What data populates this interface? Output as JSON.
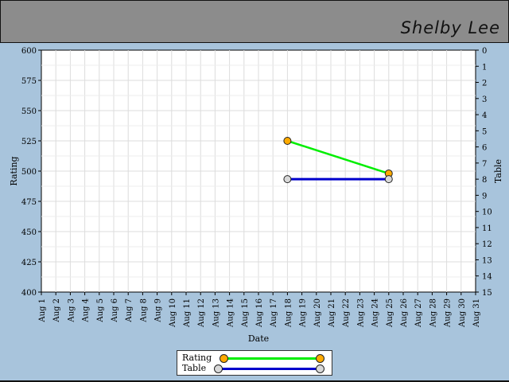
{
  "header": {
    "player_name": "Shelby Lee"
  },
  "colors": {
    "rating_line": "#00ee00",
    "table_line": "#0000cc",
    "rating_marker": "#ffaa00",
    "table_marker": "#d8d8d8"
  },
  "chart_data": {
    "type": "line",
    "xlabel": "Date",
    "ylabel": "Rating",
    "y2label": "Table",
    "ylim": [
      400,
      600
    ],
    "y2lim": [
      0,
      15
    ],
    "y2_reversed": true,
    "grid": true,
    "legend_placement": "bottom-center",
    "x_categories": [
      "Aug 1",
      "Aug 2",
      "Aug 3",
      "Aug 4",
      "Aug 5",
      "Aug 6",
      "Aug 7",
      "Aug 8",
      "Aug 9",
      "Aug 10",
      "Aug 11",
      "Aug 12",
      "Aug 13",
      "Aug 14",
      "Aug 15",
      "Aug 16",
      "Aug 17",
      "Aug 18",
      "Aug 19",
      "Aug 20",
      "Aug 21",
      "Aug 22",
      "Aug 23",
      "Aug 24",
      "Aug 25",
      "Aug 26",
      "Aug 27",
      "Aug 28",
      "Aug 29",
      "Aug 30",
      "Aug 31"
    ],
    "y_ticks": [
      400,
      425,
      450,
      475,
      500,
      525,
      550,
      575,
      600
    ],
    "y2_ticks": [
      0,
      1,
      2,
      3,
      4,
      5,
      6,
      7,
      8,
      9,
      10,
      11,
      12,
      13,
      14,
      15
    ],
    "series": [
      {
        "name": "Rating",
        "axis": "left",
        "x": [
          "Aug 18",
          "Aug 25"
        ],
        "values": [
          525,
          498
        ]
      },
      {
        "name": "Table",
        "axis": "right",
        "x": [
          "Aug 18",
          "Aug 25"
        ],
        "values": [
          8,
          8
        ]
      }
    ]
  }
}
